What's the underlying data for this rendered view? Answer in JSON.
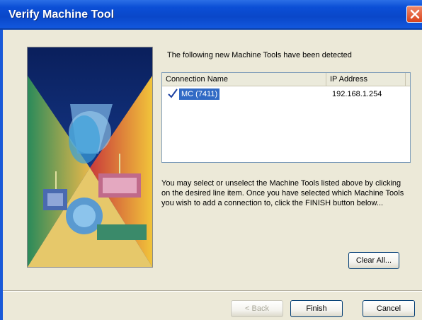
{
  "window": {
    "title": "Verify Machine Tool"
  },
  "main": {
    "detected_label": "The following new Machine Tools have been detected",
    "list": {
      "columns": [
        "Connection Name",
        "IP Address"
      ],
      "rows": [
        {
          "name": "MC (7411)",
          "ip": "192.168.1.254",
          "checked": true,
          "selected": true
        }
      ]
    },
    "info_text": "You may select or unselect the Machine Tools listed above by clicking on the desired line item.  Once you have selected which Machine Tools you wish to add a connection to, click the FINISH button below...",
    "clear_all_label": "Clear All..."
  },
  "footer": {
    "back_label": "< Back",
    "finish_label": "Finish",
    "cancel_label": "Cancel"
  },
  "colors": {
    "title_bar": "#0b4fd6",
    "selection": "#316ac5",
    "close_button": "#d9431c"
  }
}
